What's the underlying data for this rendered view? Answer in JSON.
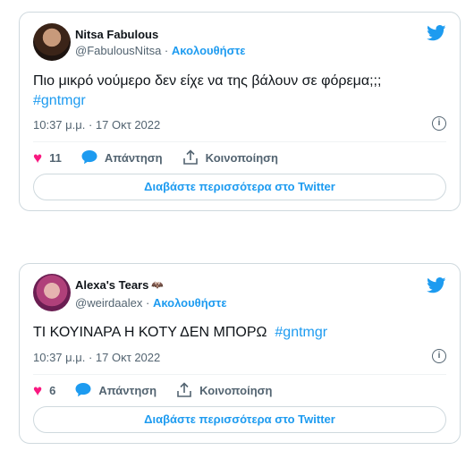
{
  "tweets": [
    {
      "display_name": "Nitsa Fabulous",
      "badge": "",
      "handle": "@FabulousNitsa",
      "separator": "·",
      "follow_label": "Ακολουθήστε",
      "text": "Πιο μικρό νούμερο δεν είχε να της βάλουν σε φόρεμα;;;",
      "hashtag": "#gntmgr",
      "timestamp": "10:37 μ.μ. · 17 Οκτ 2022",
      "like_count": "11",
      "reply_label": "Απάντηση",
      "share_label": "Κοινοποίηση",
      "read_more_label": "Διαβάστε περισσότερα στο Twitter"
    },
    {
      "display_name": "Alexa's Tears",
      "badge": "🦇",
      "handle": "@weirdaalex",
      "separator": "·",
      "follow_label": "Ακολουθήστε",
      "text": "ΤΙ ΚΟΥΙΝΑΡΑ Η ΚΟΤΥ ΔΕΝ ΜΠΟΡΩ",
      "hashtag": "#gntmgr",
      "timestamp": "10:37 μ.μ. · 17 Οκτ 2022",
      "like_count": "6",
      "reply_label": "Απάντηση",
      "share_label": "Κοινοποίηση",
      "read_more_label": "Διαβάστε περισσότερα στο Twitter"
    }
  ],
  "colors": {
    "accent": "#1d9bf0",
    "like": "#f91880",
    "muted": "#536471",
    "border": "#cfd9de"
  }
}
